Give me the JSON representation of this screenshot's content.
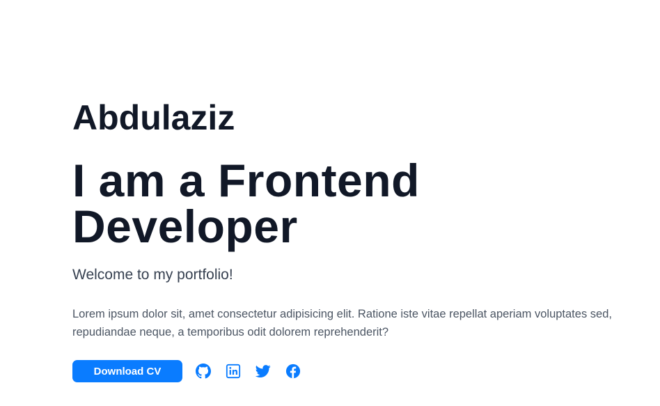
{
  "hero": {
    "name": "Abdulaziz",
    "headline": "I am a Frontend Developer",
    "welcome": "Welcome to my portfolio!",
    "intro": "Lorem ipsum dolor sit, amet consectetur adipisicing elit. Ratione iste vitae repellat aperiam voluptates sed, repudiandae neque, a temporibus odit dolorem reprehenderit?",
    "cv_button_label": "Download CV"
  },
  "social_links": [
    {
      "icon": "github-icon"
    },
    {
      "icon": "linkedin-icon"
    },
    {
      "icon": "twitter-icon"
    },
    {
      "icon": "facebook-icon"
    }
  ],
  "colors": {
    "accent": "#0a7cff",
    "heading": "#111827",
    "body_text": "#4b5563"
  }
}
